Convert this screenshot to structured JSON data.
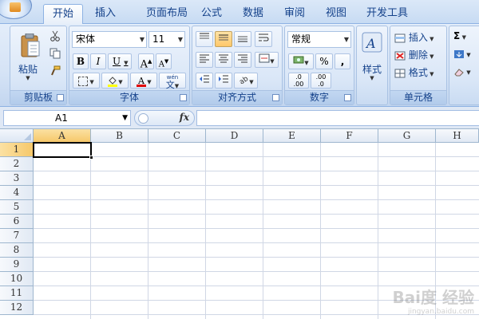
{
  "tabs": [
    {
      "label": "开始",
      "active": true
    },
    {
      "label": "插入"
    },
    {
      "label": "页面布局"
    },
    {
      "label": "公式"
    },
    {
      "label": "数据"
    },
    {
      "label": "审阅"
    },
    {
      "label": "视图"
    },
    {
      "label": "开发工具"
    }
  ],
  "ribbon": {
    "clipboard": {
      "label": "剪贴板",
      "paste": "粘贴"
    },
    "font": {
      "label": "字体",
      "font_name": "宋体",
      "font_size": "11",
      "bold": "B",
      "italic": "I",
      "underline": "U",
      "grow": "A",
      "shrink": "A",
      "pinyin_top": "wén",
      "pinyin_char": "文"
    },
    "alignment": {
      "label": "对齐方式"
    },
    "number": {
      "label": "数字",
      "format": "常规",
      "percent": "%",
      "comma": ","
    },
    "styles": {
      "label": "样式"
    },
    "cells": {
      "label": "单元格",
      "insert": "插入",
      "delete": "删除",
      "format": "格式"
    },
    "editing": {
      "sigma": "Σ"
    }
  },
  "formula_bar": {
    "name_box": "A1",
    "fx": "fx",
    "formula": ""
  },
  "grid": {
    "columns": [
      "A",
      "B",
      "C",
      "D",
      "E",
      "F",
      "G",
      "H"
    ],
    "rows": [
      "1",
      "2",
      "3",
      "4",
      "5",
      "6",
      "7",
      "8",
      "9",
      "10",
      "11",
      "12"
    ],
    "active_cell": "A1"
  },
  "colors": {
    "accent": "#15428b",
    "header_selected": "#f6c86a",
    "font_color_bar": "#e00000",
    "highlight_bar": "#ffff00"
  },
  "watermark": {
    "brand": "Bai度 经验",
    "sub": "jingyan.baidu.com"
  }
}
